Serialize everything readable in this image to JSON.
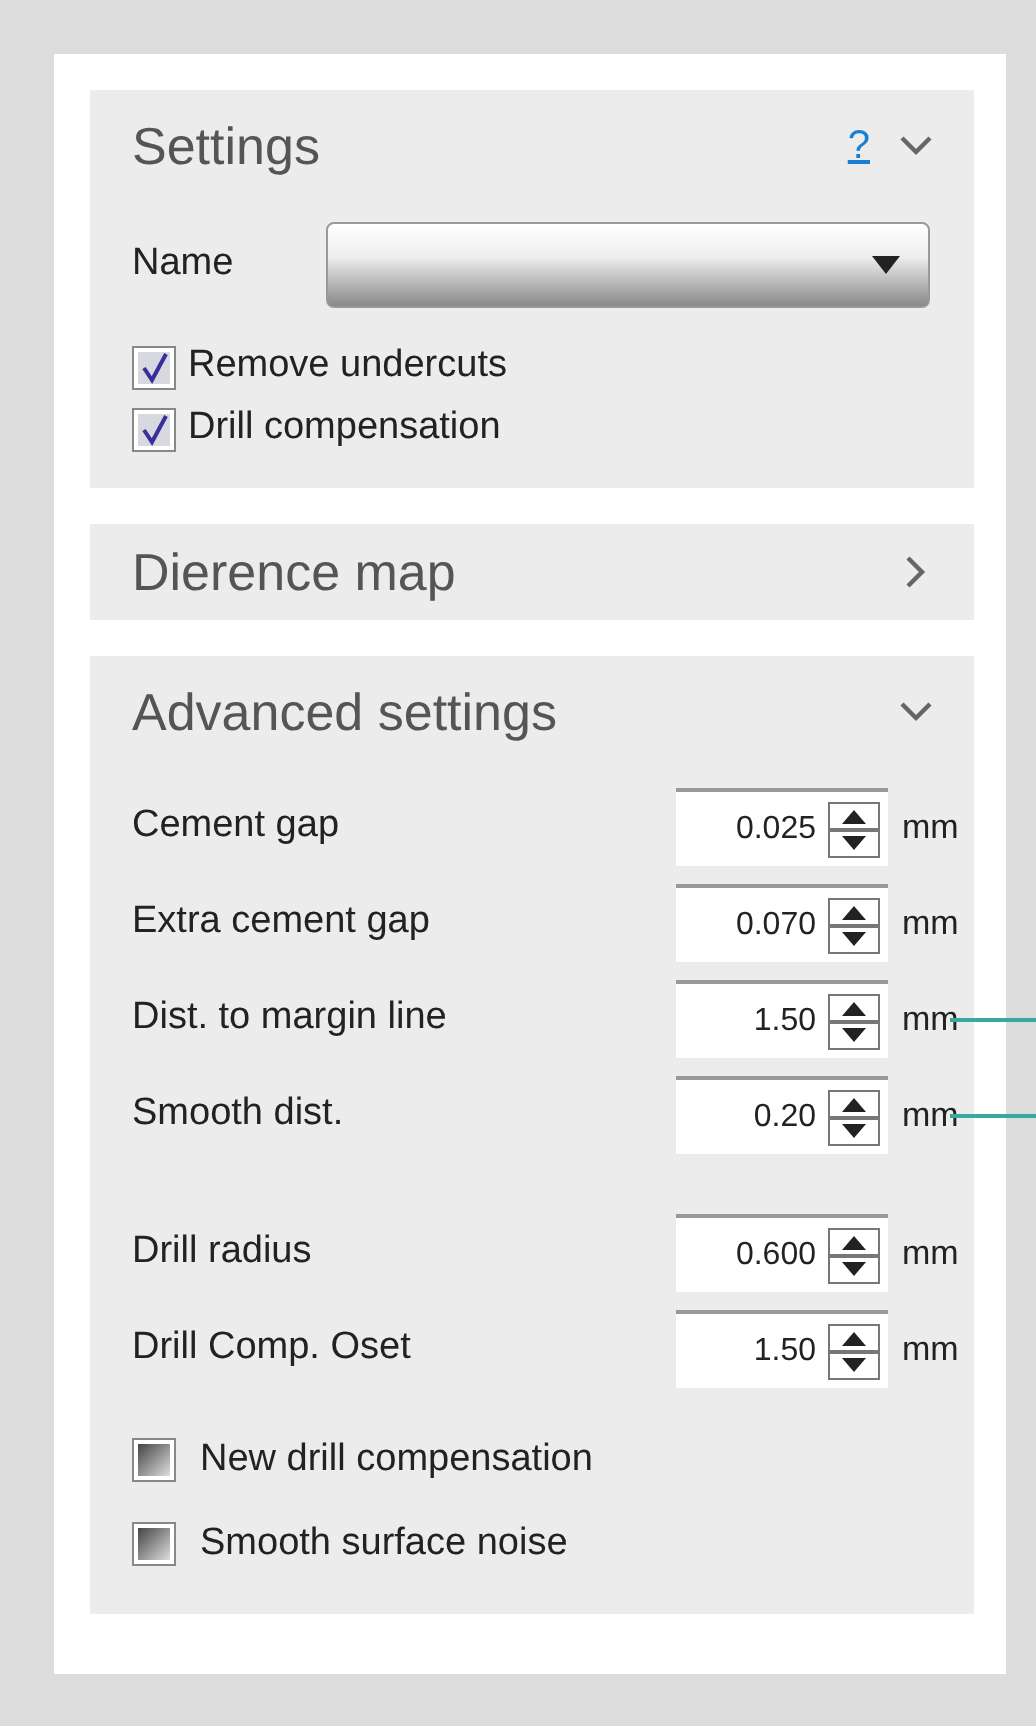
{
  "sections": [
    {
      "title": "Settings",
      "help": "?",
      "expanded": true,
      "name_field": {
        "label": "Name"
      },
      "checkboxes": [
        {
          "label": "Remove undercuts",
          "checked": true
        },
        {
          "label": "Drill compensation",
          "checked": true
        }
      ]
    },
    {
      "title": "Dierence map",
      "expanded": false
    },
    {
      "title": "Advanced settings",
      "expanded": true,
      "field_groups": [
        [
          {
            "label": "Cement gap",
            "value": "0.025",
            "unit": "mm",
            "leader": false
          },
          {
            "label": "Extra cement gap",
            "value": "0.070",
            "unit": "mm",
            "leader": false
          },
          {
            "label": "Dist. to margin line",
            "value": "1.50",
            "unit": "mm",
            "leader": true
          },
          {
            "label": "Smooth dist.",
            "value": "0.20",
            "unit": "mm",
            "leader": true
          }
        ],
        [
          {
            "label": "Drill radius",
            "value": "0.600",
            "unit": "mm",
            "leader": false
          },
          {
            "label": "Drill Comp. Oset",
            "value": "1.50",
            "unit": "mm",
            "leader": false
          }
        ]
      ],
      "checkboxes": [
        {
          "label": "New drill compensation",
          "checked": false
        },
        {
          "label": "Smooth surface noise",
          "checked": false
        }
      ]
    }
  ]
}
